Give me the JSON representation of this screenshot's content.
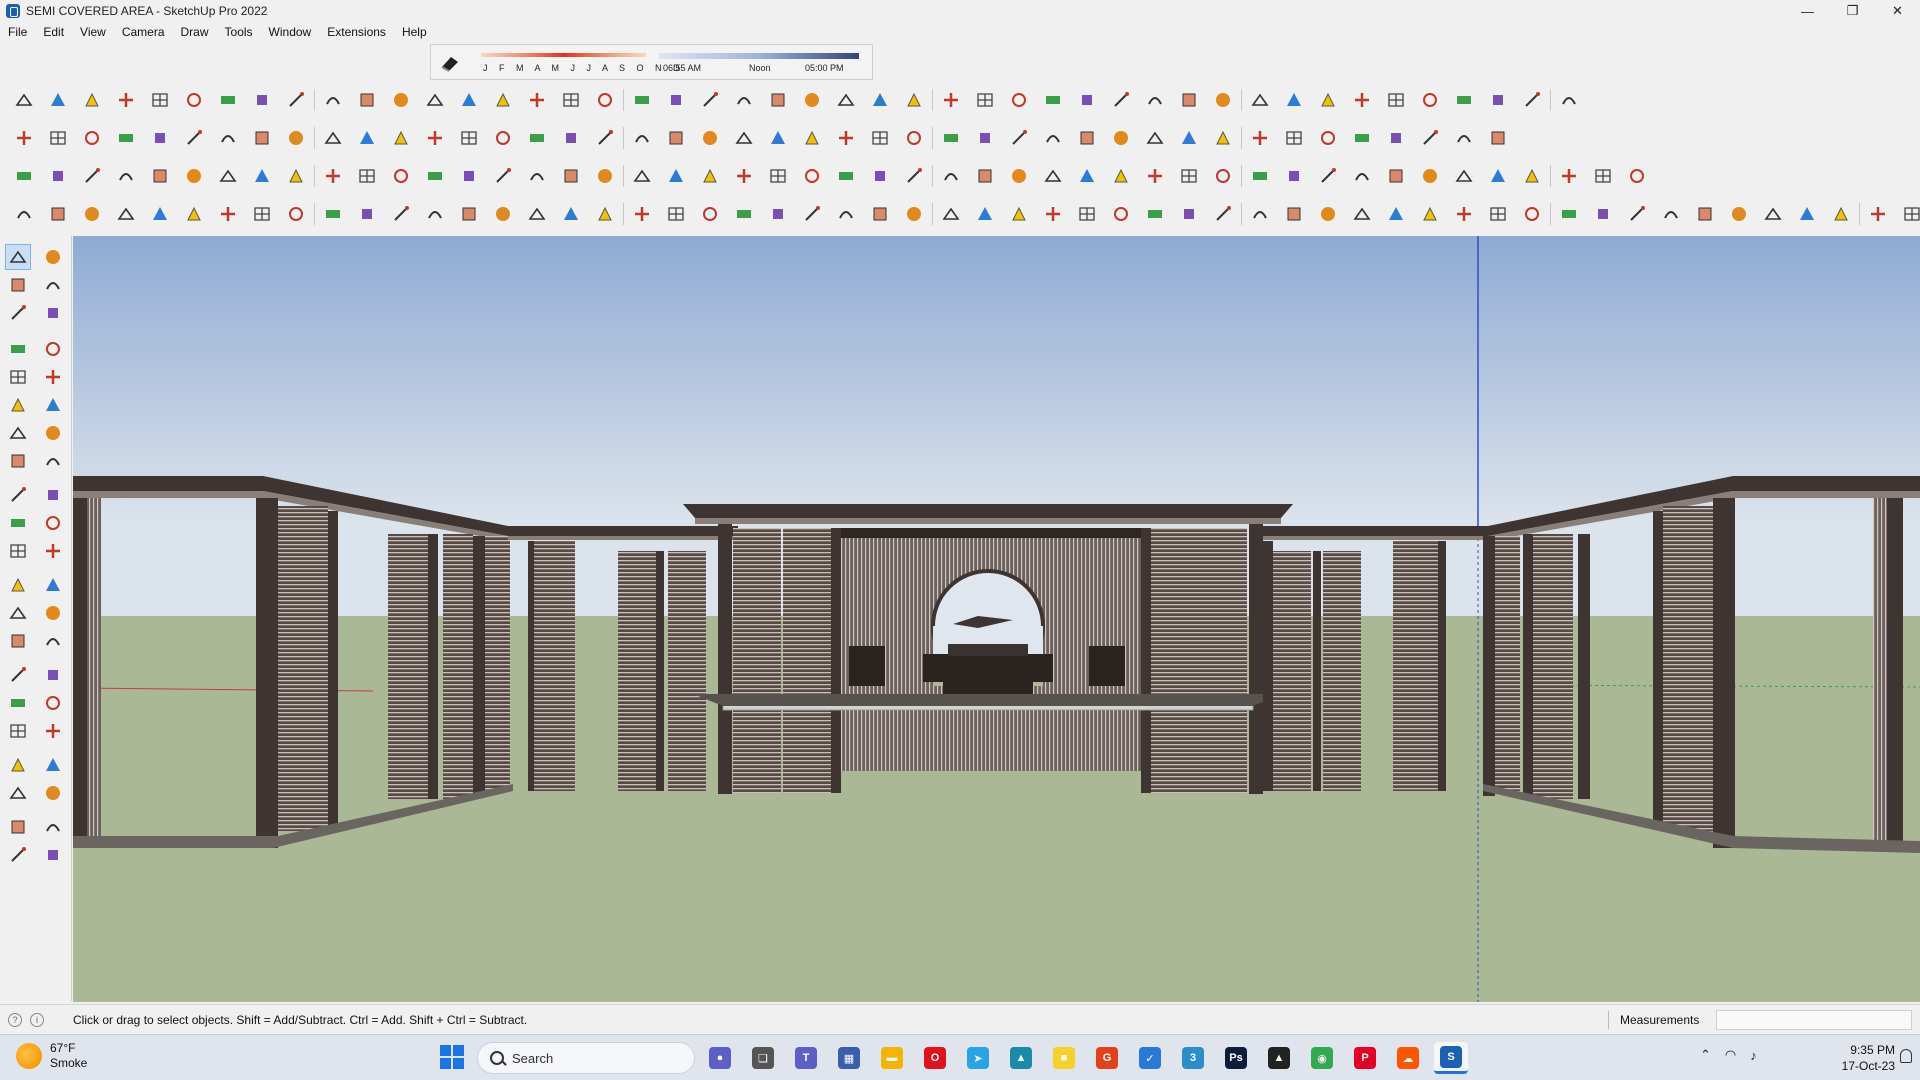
{
  "window": {
    "title": "SEMI COVERED AREA - SketchUp Pro 2022",
    "minimize": "—",
    "maximize": "❐",
    "close": "✕"
  },
  "menu": [
    "File",
    "Edit",
    "View",
    "Camera",
    "Draw",
    "Tools",
    "Window",
    "Extensions",
    "Help"
  ],
  "shadows": {
    "months": "J F M A M J J A S O N D",
    "time_start": "06:55 AM",
    "time_mid": "Noon",
    "time_end": "05:00 PM"
  },
  "status": {
    "hint": "Click or drag to select objects. Shift = Add/Subtract. Ctrl = Add. Shift + Ctrl = Subtract.",
    "measurements_label": "Measurements",
    "measurements_value": ""
  },
  "taskbar": {
    "weather_temp": "67°F",
    "weather_condition": "Smoke",
    "search_label": "Search",
    "time": "9:35 PM",
    "date": "17-Oct-23",
    "apps": [
      {
        "name": "chat",
        "color": "#5b5fc7",
        "glyph": "●"
      },
      {
        "name": "task-view",
        "color": "#555555",
        "glyph": "❑"
      },
      {
        "name": "teams",
        "color": "#5b5fc7",
        "glyph": "T"
      },
      {
        "name": "calculator",
        "color": "#3a5ea8",
        "glyph": "▦"
      },
      {
        "name": "file-explorer",
        "color": "#f2b600",
        "glyph": "▬"
      },
      {
        "name": "opera",
        "color": "#e0121b",
        "glyph": "O"
      },
      {
        "name": "telegram",
        "color": "#2aa3e0",
        "glyph": "➤"
      },
      {
        "name": "image-viewer",
        "color": "#1a8aa8",
        "glyph": "▲"
      },
      {
        "name": "sticky-notes",
        "color": "#f7d02a",
        "glyph": "■"
      },
      {
        "name": "grammarly",
        "color": "#e0431b",
        "glyph": "G"
      },
      {
        "name": "visual-studio",
        "color": "#2a79d6",
        "glyph": "✓"
      },
      {
        "name": "app-3",
        "color": "#2a8ec7",
        "glyph": "3"
      },
      {
        "name": "photoshop",
        "color": "#0b1d3a",
        "glyph": "Ps"
      },
      {
        "name": "autodesk",
        "color": "#222222",
        "glyph": "▲"
      },
      {
        "name": "chrome",
        "color": "#34a853",
        "glyph": "◉"
      },
      {
        "name": "pinterest",
        "color": "#e60023",
        "glyph": "P"
      },
      {
        "name": "soundcloud",
        "color": "#ff5500",
        "glyph": "☁"
      },
      {
        "name": "sketchup",
        "color": "#1d5fb0",
        "glyph": "S"
      }
    ]
  },
  "colors": {
    "sky_top": "#93aed4",
    "sky_bottom": "#dbe4ec",
    "ground": "#aab896",
    "structure": "#3e3532",
    "axis_blue": "#3050c8",
    "axis_red": "#c04040"
  }
}
